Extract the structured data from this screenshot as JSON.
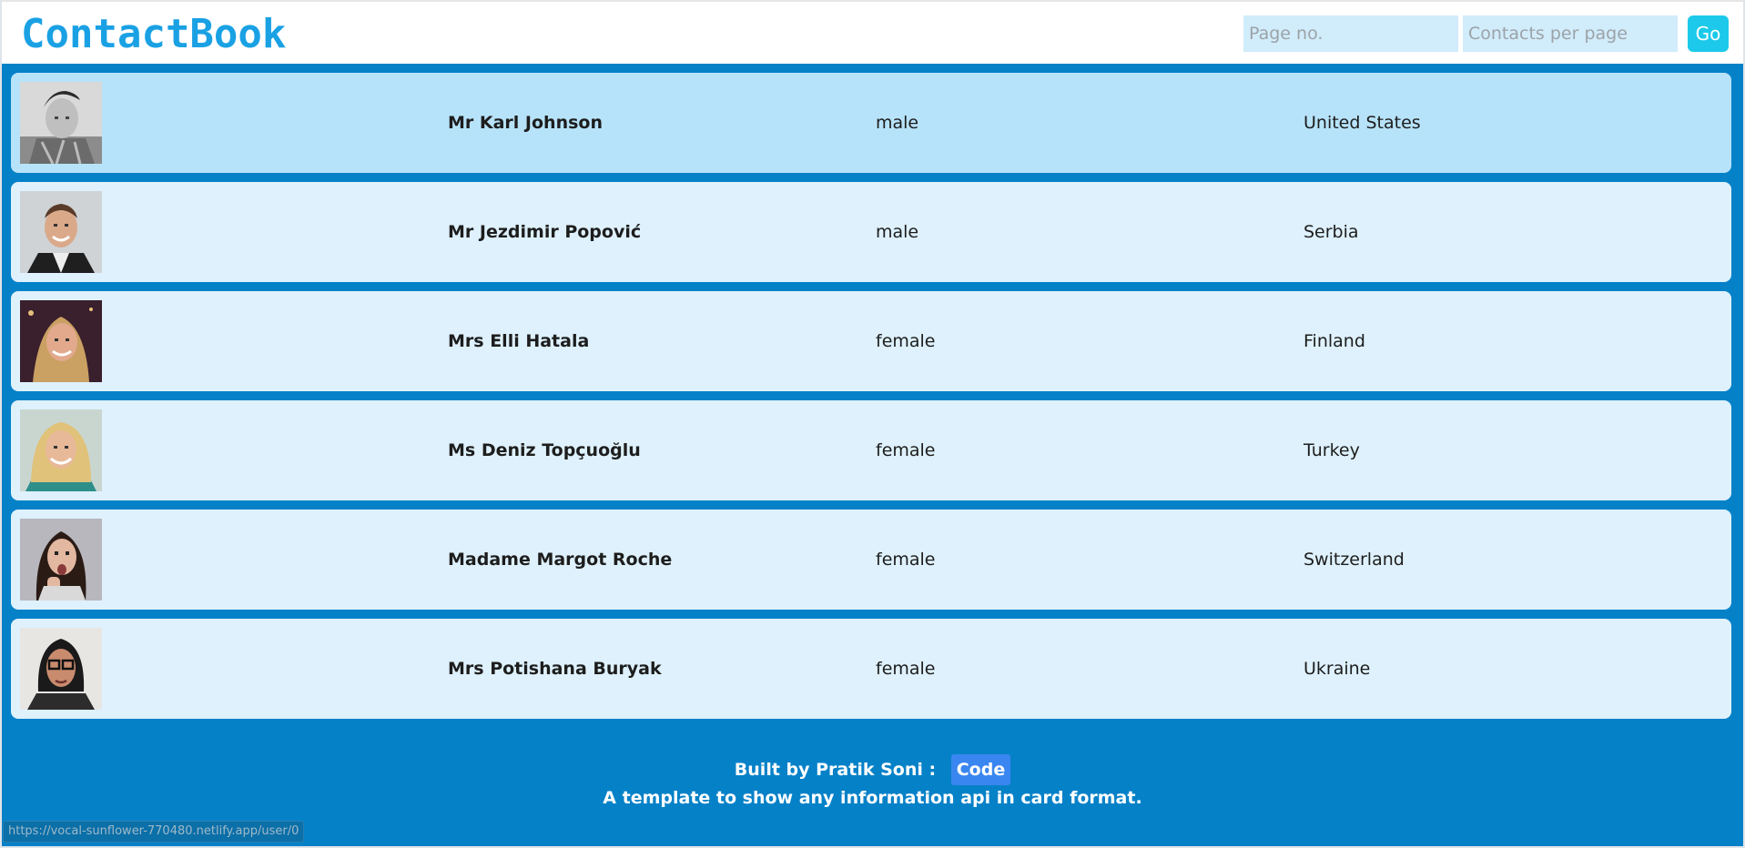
{
  "header": {
    "brand": "ContactBook",
    "page_placeholder": "Page no.",
    "per_page_placeholder": "Contacts per page",
    "go_label": "Go"
  },
  "contacts": [
    {
      "name": "Mr Karl Johnson",
      "gender": "male",
      "country": "United States",
      "avatar": "portrait-grayscale-man"
    },
    {
      "name": "Mr Jezdimir Popović",
      "gender": "male",
      "country": "Serbia",
      "avatar": "portrait-smiling-man"
    },
    {
      "name": "Mrs Elli Hatala",
      "gender": "female",
      "country": "Finland",
      "avatar": "portrait-woman-dark"
    },
    {
      "name": "Ms Deniz Topçuoğlu",
      "gender": "female",
      "country": "Turkey",
      "avatar": "portrait-blonde-woman"
    },
    {
      "name": "Madame Margot Roche",
      "gender": "female",
      "country": "Switzerland",
      "avatar": "portrait-surprised-woman"
    },
    {
      "name": "Mrs Potishana Buryak",
      "gender": "female",
      "country": "Ukraine",
      "avatar": "portrait-woman-glasses"
    }
  ],
  "footer": {
    "built_by": "Built by Pratik Soni :",
    "code_label": "Code",
    "tagline": "A template to show any information api in card format."
  },
  "status_bar": {
    "url": "https://vocal-sunflower-770480.netlify.app/user/0"
  },
  "colors": {
    "background": "#0581c8",
    "card": "#def1fc",
    "card_active": "#b7e3fa",
    "brand": "#1aa1e4",
    "go_button": "#1cc9ea",
    "code_button": "#3a86f0"
  }
}
